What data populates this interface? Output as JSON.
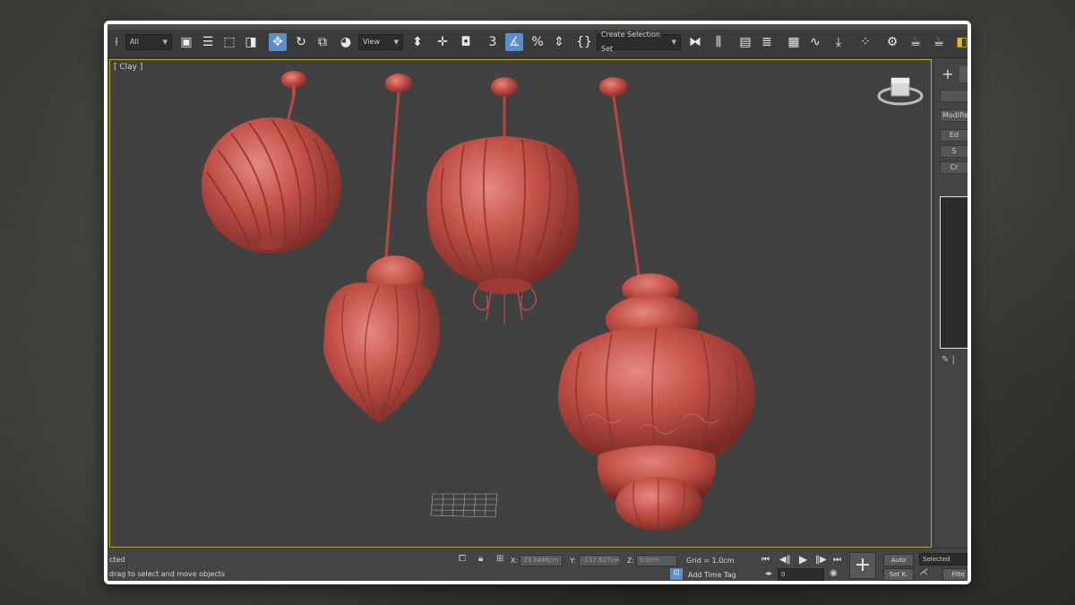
{
  "toolbar": {
    "selection_filter": "All",
    "reference_coord": "View",
    "named_selection": "Create Selection Set",
    "icons": [
      "snap-icon",
      "select-object-icon",
      "select-by-name-icon",
      "rect-region-icon",
      "window-crossing-icon",
      "move-icon",
      "rotate-icon",
      "scale-icon",
      "select-manipulate-icon",
      "pivot-icon",
      "select-link-icon",
      "keyboard-shortcut-icon",
      "snaps-3d-icon",
      "angle-snap-icon",
      "percent-snap-icon",
      "spinner-snap-icon",
      "edit-named-selection-icon",
      "mirror-icon",
      "align-icon",
      "scene-explorer-icon",
      "layer-explorer-icon",
      "ribbon-icon",
      "curve-editor-icon",
      "schematic-icon",
      "material-editor-icon",
      "render-setup-icon",
      "render-frame-icon",
      "render-icon"
    ]
  },
  "viewport": {
    "label": "[ Clay ]"
  },
  "command_panel": {
    "field1": "",
    "modifier_list": "Modifier",
    "btn1": "Ed",
    "btn2": "S",
    "btn3": "Cr"
  },
  "status": {
    "selection_text": "cted",
    "prompt": "drag to select and move objects",
    "x_label": "X:",
    "x_value": "23.6488cm",
    "y_label": "Y:",
    "y_value": "-117.627cm",
    "z_label": "Z:",
    "z_value": "0.0cm",
    "grid": "Grid = 1.0cm",
    "add_time_tag": "Add Time Tag",
    "frame": "0",
    "auto_key": "Auto",
    "set_key": "Set K.",
    "key_filter": "Selected",
    "filters": "Filte"
  },
  "colors": {
    "clay": "#c4524a",
    "viewport_border": "#bca52b",
    "active_tool": "#5b8fc9"
  }
}
